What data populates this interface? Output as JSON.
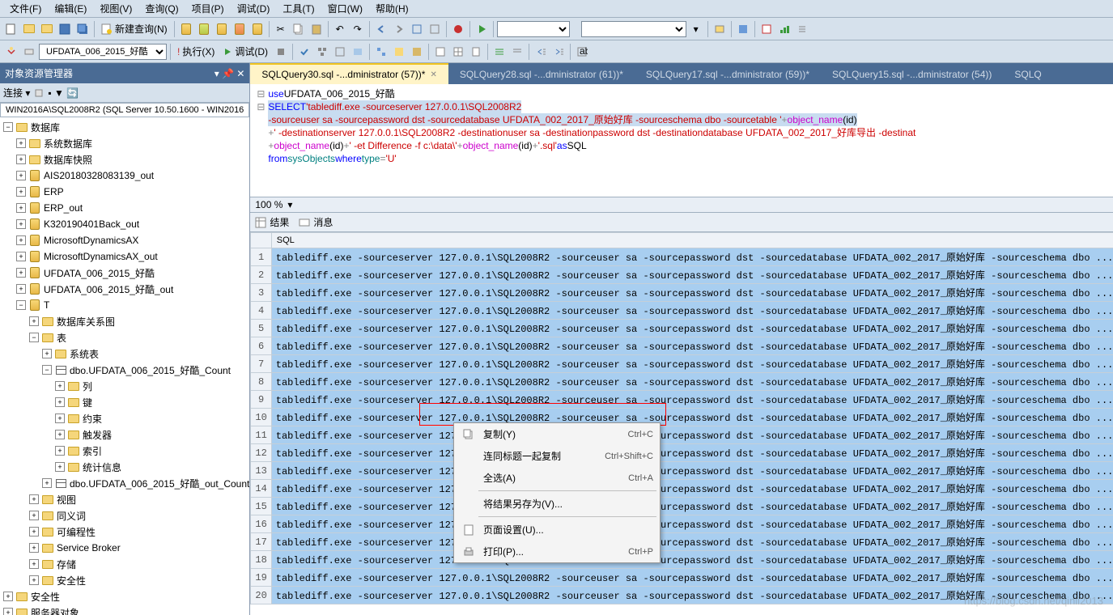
{
  "menu": [
    "文件(F)",
    "编辑(E)",
    "视图(V)",
    "查询(Q)",
    "项目(P)",
    "调试(D)",
    "工具(T)",
    "窗口(W)",
    "帮助(H)"
  ],
  "toolbar1": {
    "newquery": "新建查询(N)"
  },
  "toolbar2": {
    "db": "UFDATA_006_2015_好酷",
    "execute": "执行(X)",
    "debug": "调试(D)"
  },
  "sidebar": {
    "title": "对象资源管理器",
    "connect": "连接 ▾",
    "server": "WIN2016A\\SQL2008R2 (SQL Server 10.50.1600 - WIN2016",
    "databases": "数据库",
    "items": [
      {
        "label": "系统数据库",
        "exp": "+",
        "type": "folder"
      },
      {
        "label": "数据库快照",
        "exp": "+",
        "type": "folder"
      },
      {
        "label": "AIS20180328083139_out",
        "exp": "+",
        "type": "db"
      },
      {
        "label": "ERP",
        "exp": "+",
        "type": "db"
      },
      {
        "label": "ERP_out",
        "exp": "+",
        "type": "db"
      },
      {
        "label": "K320190401Back_out",
        "exp": "+",
        "type": "db"
      },
      {
        "label": "MicrosoftDynamicsAX",
        "exp": "+",
        "type": "db"
      },
      {
        "label": "MicrosoftDynamicsAX_out",
        "exp": "+",
        "type": "db"
      },
      {
        "label": "UFDATA_006_2015_好酷",
        "exp": "+",
        "type": "db"
      },
      {
        "label": "UFDATA_006_2015_好酷_out",
        "exp": "+",
        "type": "db"
      }
    ],
    "tdb": "T",
    "tdb_children": [
      {
        "label": "数据库关系图",
        "exp": "+",
        "indent": 3
      },
      {
        "label": "表",
        "exp": "-",
        "indent": 3
      }
    ],
    "tables": [
      {
        "label": "系统表",
        "exp": "+",
        "indent": 4
      },
      {
        "label": "dbo.UFDATA_006_2015_好酷_Count",
        "exp": "-",
        "indent": 4,
        "type": "table"
      }
    ],
    "tablecols": [
      {
        "label": "列",
        "exp": "+"
      },
      {
        "label": "键",
        "exp": "+"
      },
      {
        "label": "约束",
        "exp": "+"
      },
      {
        "label": "触发器",
        "exp": "+"
      },
      {
        "label": "索引",
        "exp": "+"
      },
      {
        "label": "统计信息",
        "exp": "+"
      }
    ],
    "table2": "dbo.UFDATA_006_2015_好酷_out_Count",
    "rest": [
      {
        "label": "视图",
        "exp": "+"
      },
      {
        "label": "同义词",
        "exp": "+"
      },
      {
        "label": "可编程性",
        "exp": "+"
      },
      {
        "label": "Service Broker",
        "exp": "+"
      },
      {
        "label": "存储",
        "exp": "+"
      },
      {
        "label": "安全性",
        "exp": "+"
      }
    ],
    "security": "安全性",
    "serverobj": "服务器对象"
  },
  "tabs": [
    {
      "label": "SQLQuery30.sql -...dministrator (57))*",
      "active": true
    },
    {
      "label": "SQLQuery28.sql -...dministrator (61))*"
    },
    {
      "label": "SQLQuery17.sql -...dministrator (59))*"
    },
    {
      "label": "SQLQuery15.sql -...dministrator (54))"
    },
    {
      "label": "SQLQ"
    }
  ],
  "code": {
    "l1a": "use",
    "l1b": " UFDATA_006_2015_好酷",
    "l2a": "SELECT ",
    "l2b": "'tablediff.exe -sourceserver 127.0.0.1\\SQL2008R2",
    "l3": "-sourceuser sa -sourcepassword dst -sourcedatabase UFDATA_002_2017_原始好库 -sourceschema dbo -sourcetable '",
    "l3b": "+",
    "l3c": "object_name",
    "l3d": " (id)",
    "l4a": "+",
    "l4b": "' -destinationserver 127.0.0.1\\SQL2008R2 -destinationuser sa -destinationpassword dst -destinationdatabase UFDATA_002_2017_好库导出 -destinat",
    "l5a": "+",
    "l5b": "object_name",
    "l5c": " (id)",
    "l5d": "+",
    "l5e": "'  -et Difference -f c:\\data\\'",
    "l5f": "+",
    "l5g": "object_name",
    "l5h": " (id)",
    "l5i": "+",
    "l5j": "'.sql'",
    "l5k": " as",
    " l5l": " SQL",
    "l6a": "from ",
    "l6b": "sysObjects",
    "l6c": " where ",
    "l6d": "type ",
    "l6e": "=",
    "l6f": "'U'"
  },
  "zoom": "100 %",
  "resulttabs": {
    "results": "结果",
    "messages": "消息"
  },
  "grid": {
    "header": "SQL",
    "row": "tablediff.exe -sourceserver 127.0.0.1\\SQL2008R2    -sourceuser sa -sourcepassword dst -sourcedatabase UFDATA_002_2017_原始好库 -sourceschema dbo ...",
    "rowshort": "tablediff.exe -sourceserver",
    "rowmid": "epassword dst -sourcedatabase UFDATA_002_2017_原始好库 -sourceschema dbo ...",
    "count": 20
  },
  "contextmenu": [
    {
      "label": "复制(Y)",
      "shortcut": "Ctrl+C",
      "icon": "copy"
    },
    {
      "label": "连同标题一起复制",
      "shortcut": "Ctrl+Shift+C"
    },
    {
      "label": "全选(A)",
      "shortcut": "Ctrl+A"
    },
    {
      "sep": true
    },
    {
      "label": "将结果另存为(V)...",
      "shortcut": ""
    },
    {
      "sep": true
    },
    {
      "label": "页面设置(U)...",
      "shortcut": "",
      "icon": "page"
    },
    {
      "label": "打印(P)...",
      "shortcut": "Ctrl+P",
      "icon": "print"
    }
  ],
  "watermark": "https://blog.csdn.net/qinli2013"
}
